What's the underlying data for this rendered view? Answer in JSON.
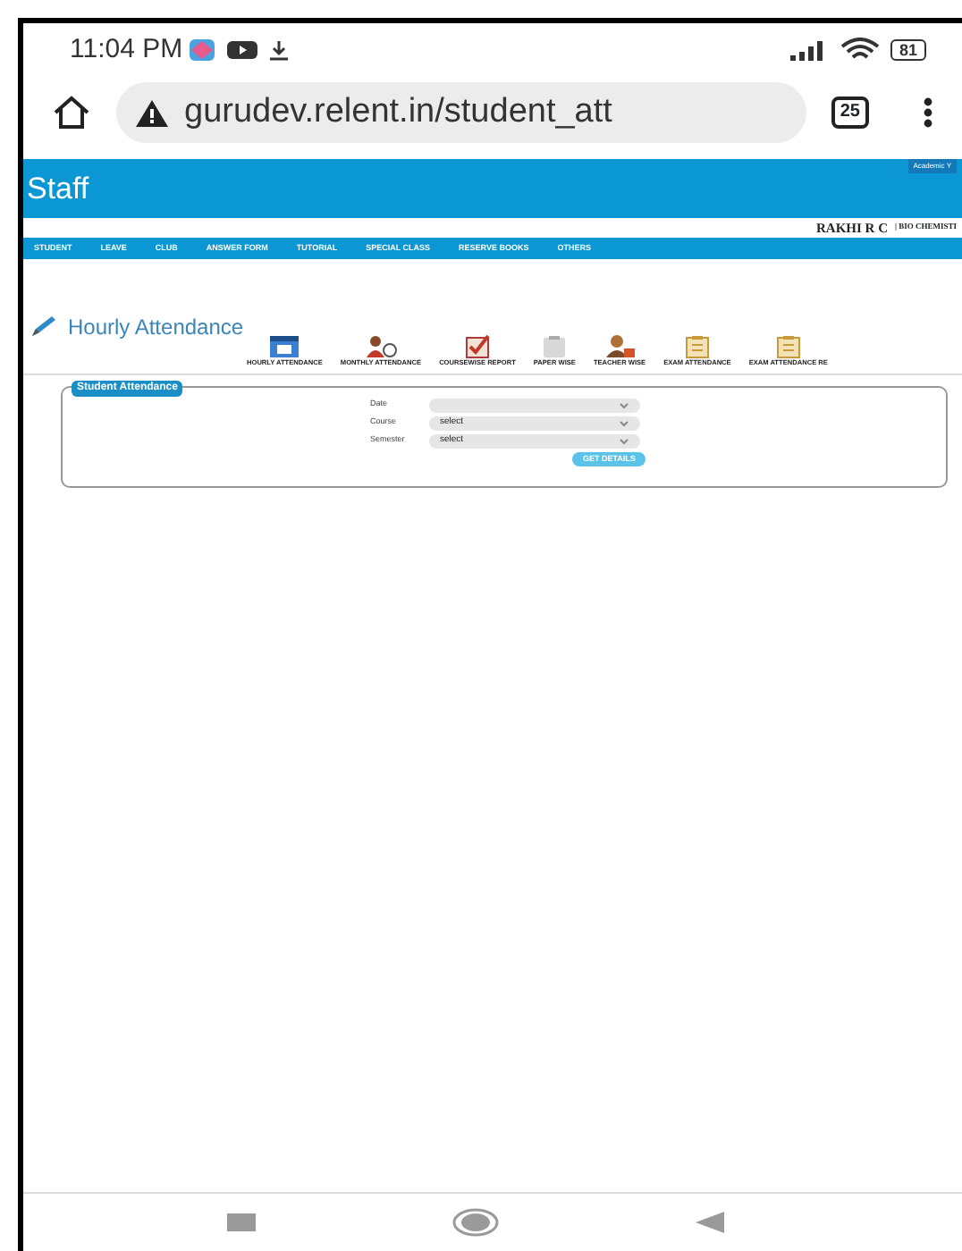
{
  "status_bar": {
    "time": "11:04 PM",
    "battery": "81"
  },
  "address_bar": {
    "url": "gurudev.relent.in/student_att",
    "tab_count": "25"
  },
  "header": {
    "logo": "Staff",
    "academic_year": "Academic Y"
  },
  "user": {
    "name": "RAKHI R C",
    "department": "| BIO CHEMISTI"
  },
  "nav": [
    "STUDENT",
    "LEAVE",
    "CLUB",
    "ANSWER FORM",
    "TUTORIAL",
    "SPECIAL CLASS",
    "RESERVE BOOKS",
    "OTHERS"
  ],
  "page_title": "Hourly Attendance",
  "shortcuts": [
    {
      "label": "HOURLY ATTENDANCE",
      "kind": "calendar"
    },
    {
      "label": "MONTHLY ATTENDANCE",
      "kind": "people"
    },
    {
      "label": "COURSEWISE REPORT",
      "kind": "checklist"
    },
    {
      "label": "PAPER WISE",
      "kind": "paper"
    },
    {
      "label": "TEACHER WISE",
      "kind": "teacher"
    },
    {
      "label": "EXAM ATTENDANCE",
      "kind": "clipboard"
    },
    {
      "label": "EXAM ATTENDANCE RE",
      "kind": "clipboard"
    }
  ],
  "form": {
    "legend": "Student Attendance",
    "fields": [
      {
        "label": "Date"
      },
      {
        "label": "Course",
        "value": "select"
      },
      {
        "label": "Semester",
        "value": "select"
      }
    ],
    "button": "GET DETAILS"
  }
}
